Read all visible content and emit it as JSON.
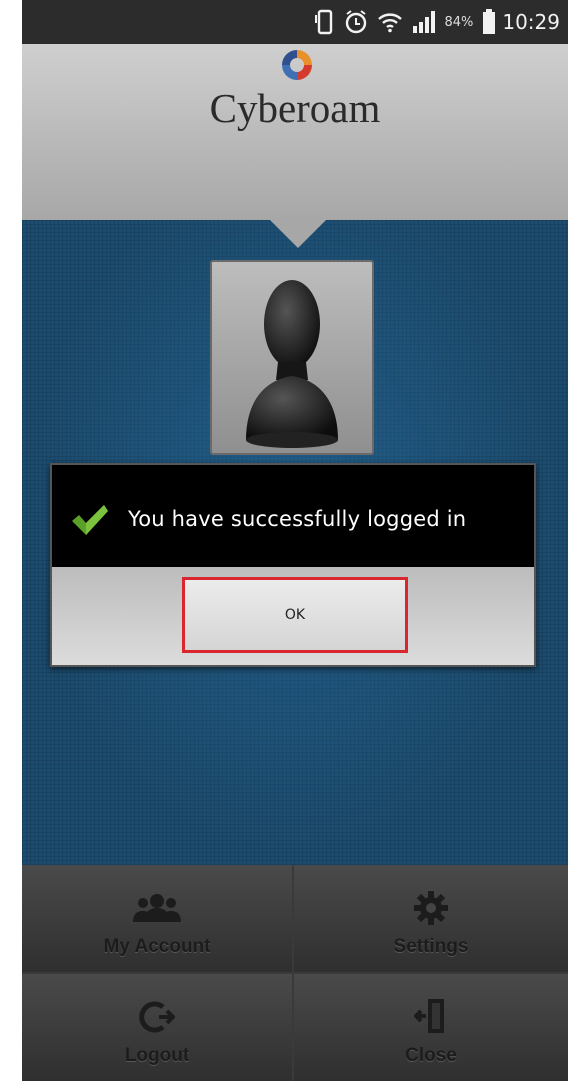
{
  "status_bar": {
    "battery_percent": "84%",
    "time": "10:29",
    "icons": [
      "vibrate-icon",
      "alarm-icon",
      "wifi-icon",
      "signal-icon",
      "battery-icon"
    ]
  },
  "header": {
    "logo_text": "Cyberoam"
  },
  "dialog": {
    "message": "You have successfully logged in",
    "ok_label": "OK",
    "icon": "checkmark-icon",
    "highlight_color": "#d9262f"
  },
  "menu": {
    "my_account": "My Account",
    "settings": "Settings",
    "logout": "Logout",
    "close": "Close"
  },
  "colors": {
    "background_blue": "#1b4b6e",
    "check_green": "#5aa12a"
  }
}
